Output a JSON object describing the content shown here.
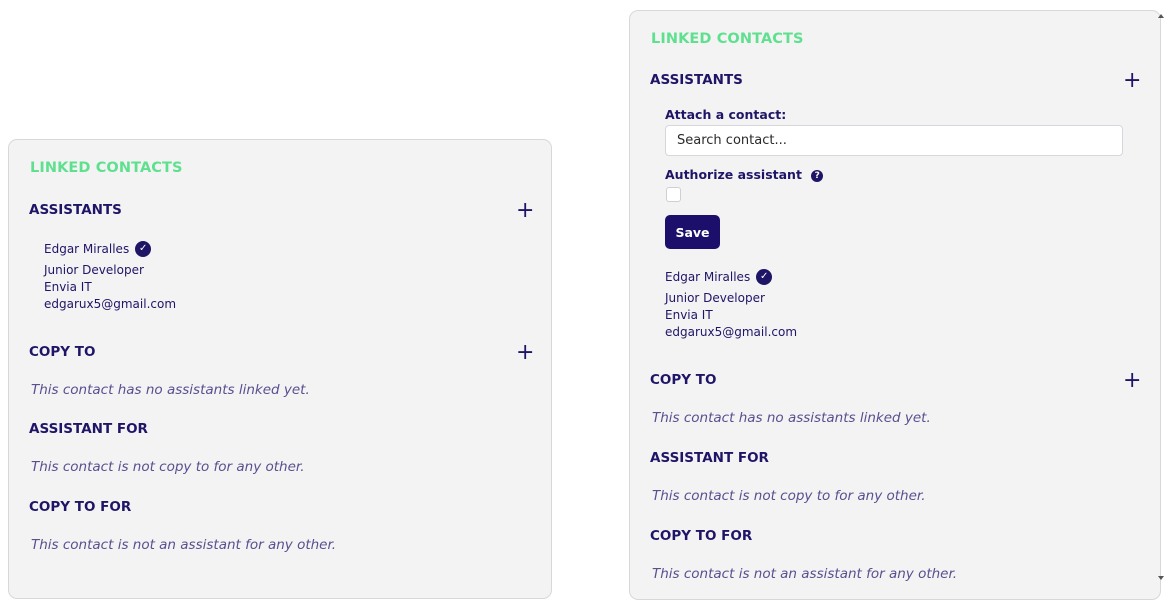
{
  "left_panel": {
    "title": "LINKED CONTACTS",
    "assistants": {
      "heading": "ASSISTANTS",
      "add_icon": "+",
      "contact": {
        "name": "Edgar Miralles",
        "verified_icon": "✓",
        "role": "Junior Developer",
        "company": "Envia IT",
        "email": "edgarux5@gmail.com"
      }
    },
    "copy_to": {
      "heading": "COPY TO",
      "add_icon": "+",
      "empty_text": "This contact has no assistants linked yet."
    },
    "assistant_for": {
      "heading": "ASSISTANT FOR",
      "empty_text": "This contact is not copy to for any other."
    },
    "copy_to_for": {
      "heading": "COPY TO FOR",
      "empty_text": "This contact is not an assistant for any other."
    }
  },
  "right_panel": {
    "title": "LINKED CONTACTS",
    "assistants": {
      "heading": "ASSISTANTS",
      "add_icon": "+",
      "form": {
        "attach_label": "Attach a contact:",
        "search_placeholder": "Search contact...",
        "authorize_label": "Authorize assistant",
        "help_icon": "?",
        "authorize_checked": false,
        "save_label": "Save"
      },
      "contact": {
        "name": "Edgar Miralles",
        "verified_icon": "✓",
        "role": "Junior Developer",
        "company": "Envia IT",
        "email": "edgarux5@gmail.com"
      }
    },
    "copy_to": {
      "heading": "COPY TO",
      "add_icon": "+",
      "empty_text": "This contact has no assistants linked yet."
    },
    "assistant_for": {
      "heading": "ASSISTANT FOR",
      "empty_text": "This contact is not copy to for any other."
    },
    "copy_to_for": {
      "heading": "COPY TO FOR",
      "empty_text": "This contact is not an assistant for any other."
    }
  },
  "colors": {
    "accent_green": "#5fe08f",
    "primary_navy": "#1f1566",
    "button_bg": "#1c0f6b",
    "panel_bg": "#f3f3f4"
  }
}
